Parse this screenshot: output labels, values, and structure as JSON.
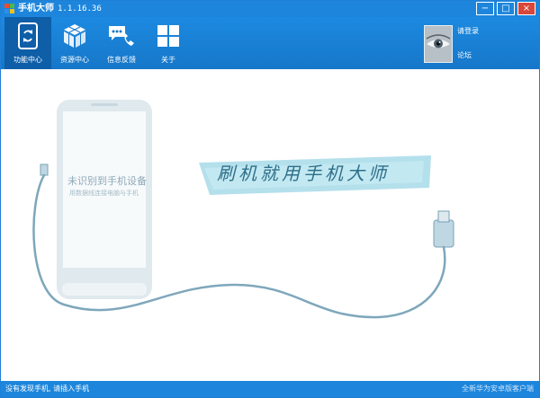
{
  "window": {
    "title": "手机大师",
    "version": "1.1.16.36",
    "controls": {
      "minimize": "−",
      "maximize": "□",
      "close": "×"
    },
    "colors": {
      "primary": "#1d86dc",
      "active": "#0e5ea8",
      "close": "#d8473a"
    }
  },
  "toolbar": {
    "items": [
      {
        "label": "功能中心",
        "icon": "phone-sync-icon",
        "active": true
      },
      {
        "label": "资源中心",
        "icon": "cube-icon",
        "active": false
      },
      {
        "label": "信息反馈",
        "icon": "chat-phone-icon",
        "active": false
      },
      {
        "label": "关于",
        "icon": "windows-icon",
        "active": false
      }
    ]
  },
  "user": {
    "avatar_icon": "eye-avatar-icon",
    "login_label": "请登录",
    "forum_label": "论坛"
  },
  "main": {
    "phone_title": "未识别到手机设备",
    "phone_hint": "用数据线连接电脑与手机",
    "slogan": "刷机就用手机大师"
  },
  "status": {
    "message": "没有发现手机, 请插入手机",
    "right_text": "全新华为安卓版客户端"
  }
}
